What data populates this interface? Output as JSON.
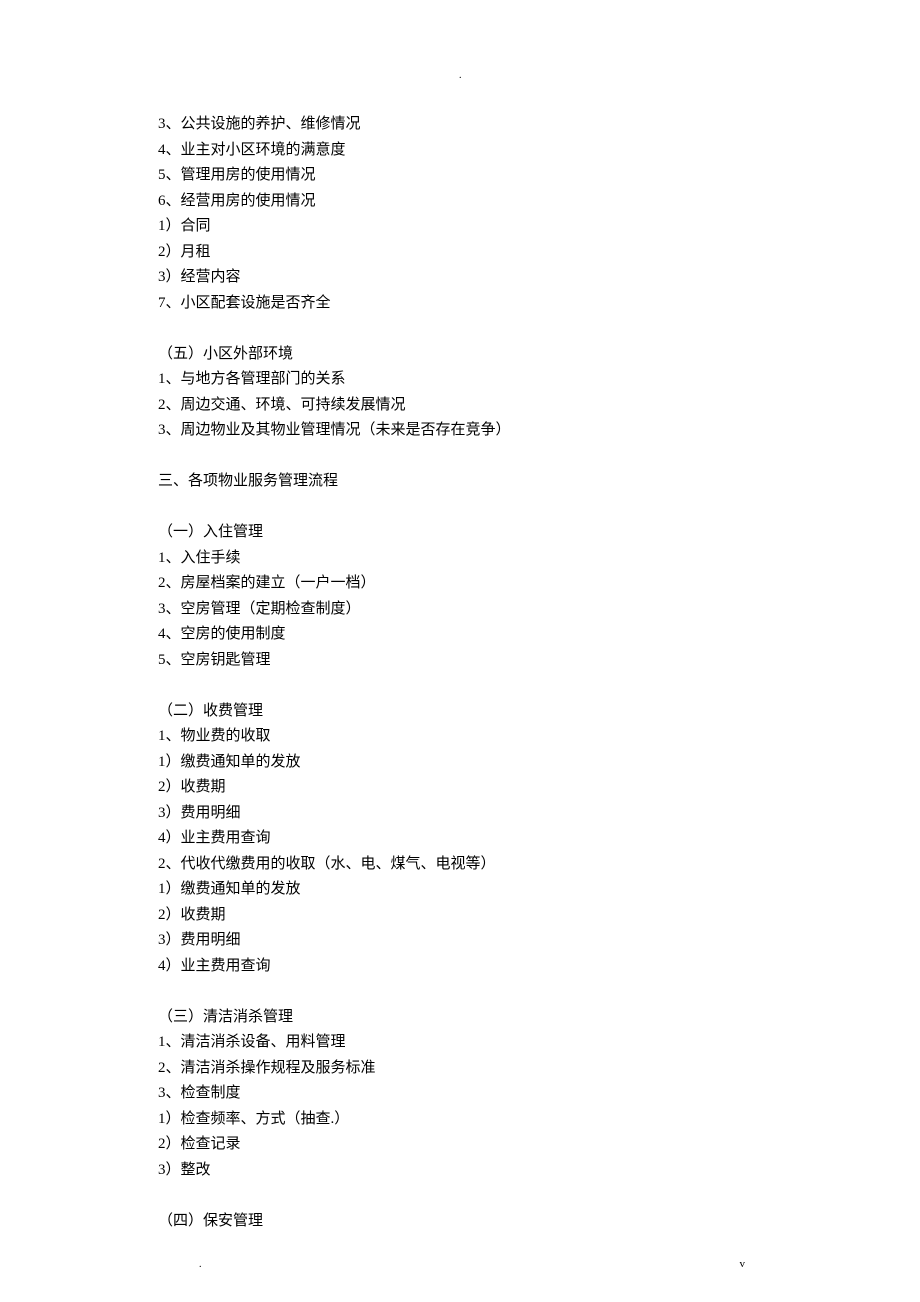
{
  "top_dot": ".",
  "bottom_left_dot": ".",
  "bottom_right_v": "v",
  "lines": [
    "3、公共设施的养护、维修情况",
    "4、业主对小区环境的满意度",
    "5、管理用房的使用情况",
    "6、经营用房的使用情况",
    "1）合同",
    "2）月租",
    "3）经营内容",
    "7、小区配套设施是否齐全",
    "",
    "（五）小区外部环境",
    "1、与地方各管理部门的关系",
    "2、周边交通、环境、可持续发展情况",
    "3、周边物业及其物业管理情况（未来是否存在竞争）",
    "",
    "三、各项物业服务管理流程",
    "",
    "（一）入住管理",
    "1、入住手续",
    "2、房屋档案的建立（一户一档）",
    "3、空房管理（定期检查制度）",
    "4、空房的使用制度",
    "5、空房钥匙管理",
    "",
    "（二）收费管理",
    "1、物业费的收取",
    "1）缴费通知单的发放",
    "2）收费期",
    "3）费用明细",
    "4）业主费用查询",
    "2、代收代缴费用的收取（水、电、煤气、电视等）",
    "1）缴费通知单的发放",
    "2）收费期",
    "3）费用明细",
    "4）业主费用查询",
    "",
    "（三）清洁消杀管理",
    "1、清洁消杀设备、用料管理",
    "2、清洁消杀操作规程及服务标准",
    "3、检查制度",
    "1）检查频率、方式（抽查.）",
    "2）检查记录",
    "3）整改",
    "",
    "（四）保安管理"
  ]
}
